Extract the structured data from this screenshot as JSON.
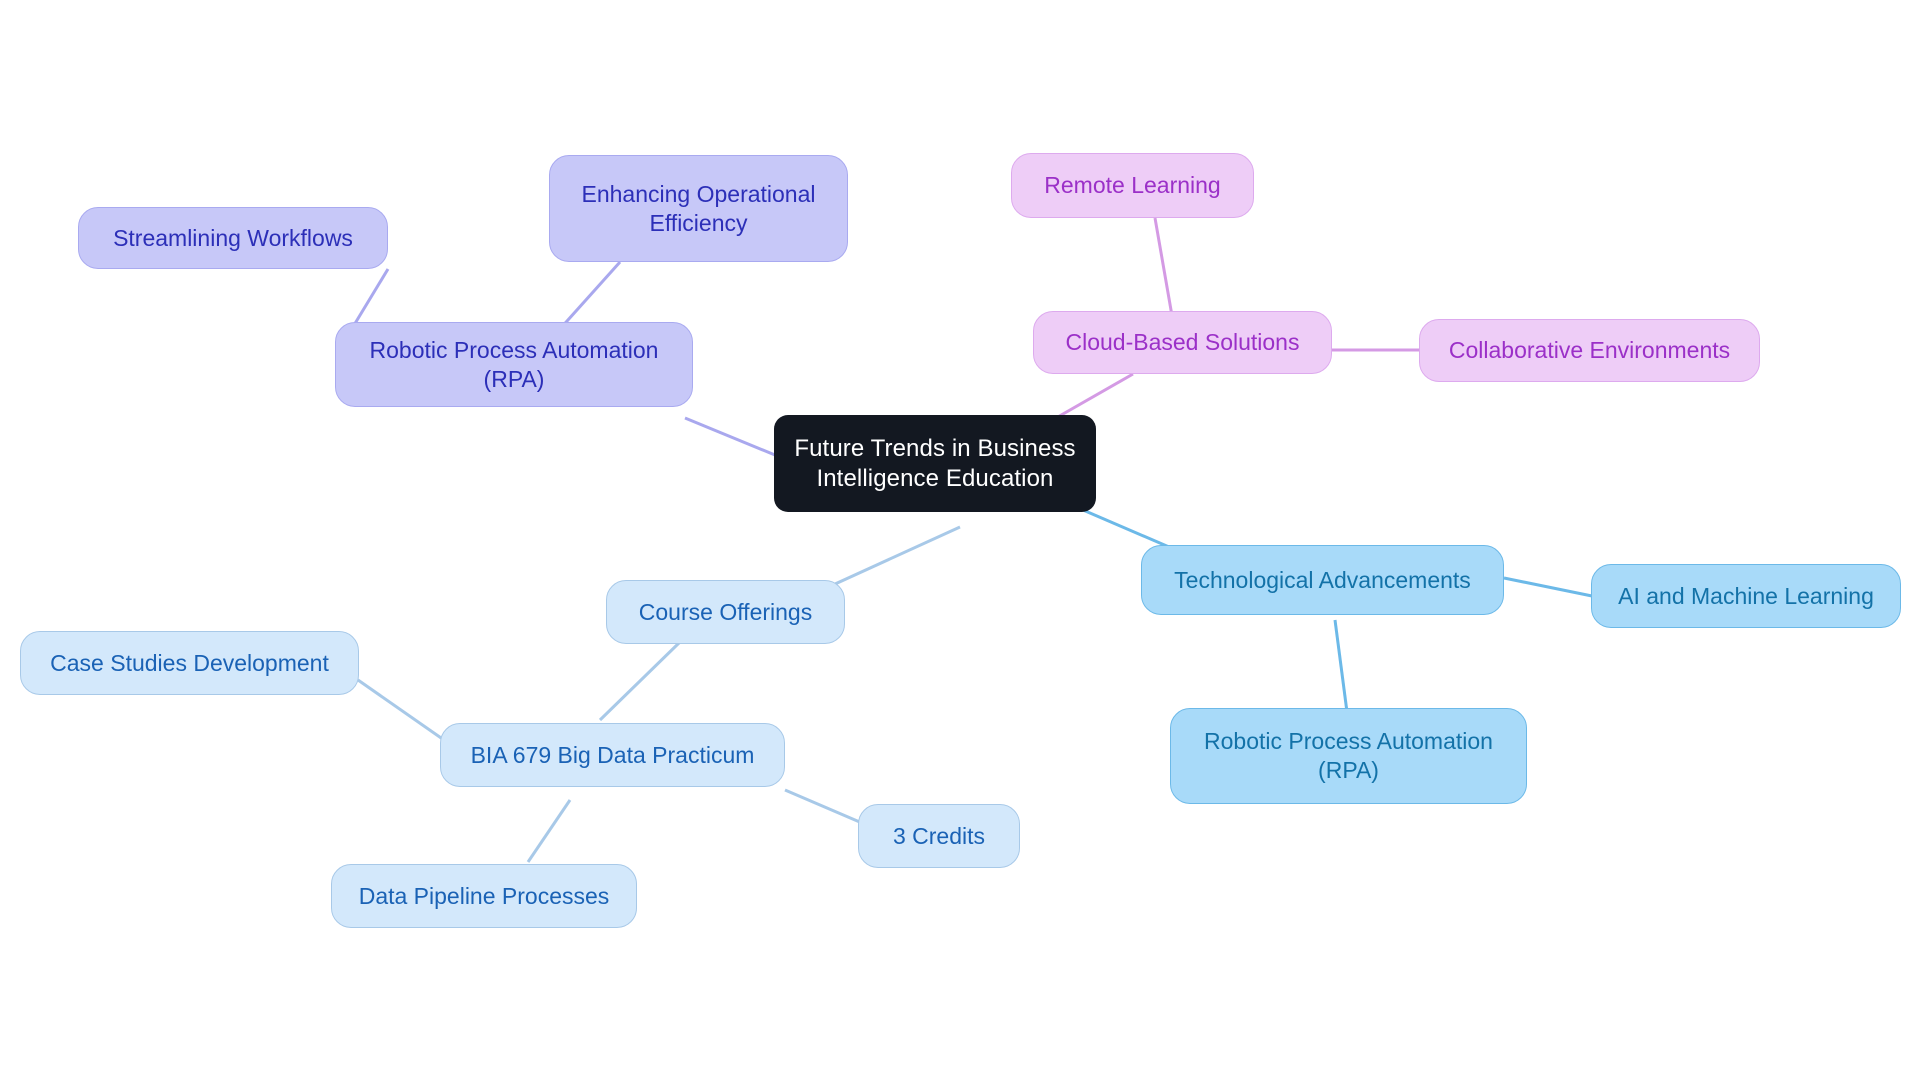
{
  "diagram": {
    "type": "mind-map",
    "title": "Future Trends in Business Intelligence Education",
    "background": "#ffffff",
    "palette": {
      "root_fill": "#131821",
      "root_text": "#ffffff",
      "purple_fill": "#c7c8f8",
      "purple_border": "#a9aaf0",
      "purple_text": "#2c2fb8",
      "purple_edge": "#a9a8ee",
      "pink_fill": "#eecdf7",
      "pink_border": "#ddaaee",
      "pink_text": "#9b30c8",
      "pink_edge": "#d49ae4",
      "blue_fill": "#a8daf9",
      "blue_border": "#6cb9e8",
      "blue_text": "#1372a8",
      "blue_edge": "#6cb9e8",
      "lightblue_fill": "#d3e8fb",
      "lightblue_border": "#a8c9e8",
      "lightblue_text": "#1a62b5",
      "lightblue_edge": "#a8c9e8"
    }
  },
  "nodes": {
    "root": {
      "label": "Future Trends in Business\nIntelligence Education"
    },
    "rpa_left": {
      "label": "Robotic Process Automation\n(RPA)"
    },
    "streamlining_workflows": {
      "label": "Streamlining Workflows"
    },
    "enhancing_operational_efficiency": {
      "label": "Enhancing Operational\nEfficiency"
    },
    "cloud_based_solutions": {
      "label": "Cloud-Based Solutions"
    },
    "remote_learning": {
      "label": "Remote Learning"
    },
    "collaborative_environments": {
      "label": "Collaborative Environments"
    },
    "technological_advancements": {
      "label": "Technological Advancements"
    },
    "ai_machine_learning": {
      "label": "AI and Machine Learning"
    },
    "rpa_blue": {
      "label": "Robotic Process Automation\n(RPA)"
    },
    "course_offerings": {
      "label": "Course Offerings"
    },
    "bia_679": {
      "label": "BIA 679 Big Data Practicum"
    },
    "case_studies_development": {
      "label": "Case Studies Development"
    },
    "data_pipeline_processes": {
      "label": "Data Pipeline Processes"
    },
    "three_credits": {
      "label": "3 Credits"
    }
  },
  "edges": [
    {
      "from": "root",
      "to": "rpa_left",
      "color": "#a9a8ee"
    },
    {
      "from": "rpa_left",
      "to": "streamlining_workflows",
      "color": "#a9a8ee"
    },
    {
      "from": "rpa_left",
      "to": "enhancing_operational_efficiency",
      "color": "#a9a8ee"
    },
    {
      "from": "root",
      "to": "cloud_based_solutions",
      "color": "#d49ae4"
    },
    {
      "from": "cloud_based_solutions",
      "to": "remote_learning",
      "color": "#d49ae4"
    },
    {
      "from": "cloud_based_solutions",
      "to": "collaborative_environments",
      "color": "#d49ae4"
    },
    {
      "from": "root",
      "to": "technological_advancements",
      "color": "#6cb9e8"
    },
    {
      "from": "technological_advancements",
      "to": "ai_machine_learning",
      "color": "#6cb9e8"
    },
    {
      "from": "technological_advancements",
      "to": "rpa_blue",
      "color": "#6cb9e8"
    },
    {
      "from": "root",
      "to": "course_offerings",
      "color": "#a8c9e8"
    },
    {
      "from": "course_offerings",
      "to": "bia_679",
      "color": "#a8c9e8"
    },
    {
      "from": "bia_679",
      "to": "case_studies_development",
      "color": "#a8c9e8"
    },
    {
      "from": "bia_679",
      "to": "data_pipeline_processes",
      "color": "#a8c9e8"
    },
    {
      "from": "bia_679",
      "to": "three_credits",
      "color": "#a8c9e8"
    }
  ]
}
